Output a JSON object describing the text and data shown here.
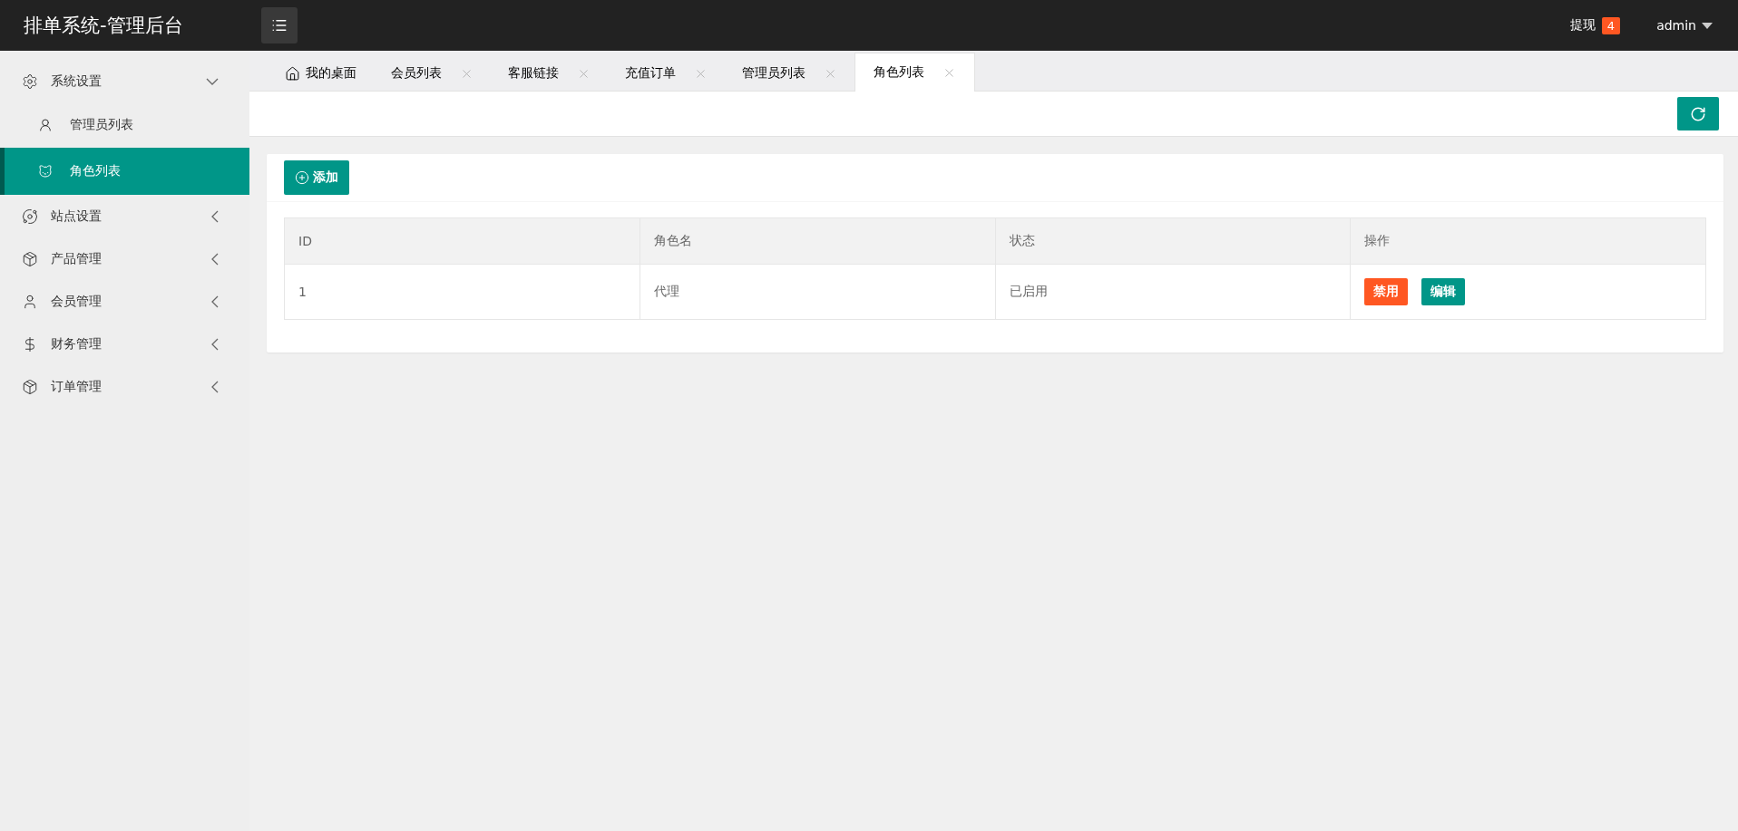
{
  "header": {
    "title": "排单系统-管理后台",
    "withdraw_label": "提现",
    "withdraw_count": "4",
    "user": "admin"
  },
  "sidebar": {
    "items": [
      {
        "label": "系统设置",
        "expanded": true,
        "children": [
          {
            "label": "管理员列表",
            "selected": false
          },
          {
            "label": "角色列表",
            "selected": true
          }
        ]
      },
      {
        "label": "站点设置",
        "expanded": false
      },
      {
        "label": "产品管理",
        "expanded": false
      },
      {
        "label": "会员管理",
        "expanded": false
      },
      {
        "label": "财务管理",
        "expanded": false
      },
      {
        "label": "订单管理",
        "expanded": false
      }
    ]
  },
  "tabs": [
    {
      "label": "我的桌面",
      "kind": "home",
      "selected": false
    },
    {
      "label": "会员列表",
      "kind": "closable",
      "selected": false
    },
    {
      "label": "客服链接",
      "kind": "closable",
      "selected": false
    },
    {
      "label": "充值订单",
      "kind": "closable",
      "selected": false
    },
    {
      "label": "管理员列表",
      "kind": "closable",
      "selected": false
    },
    {
      "label": "角色列表",
      "kind": "closable",
      "selected": true
    }
  ],
  "add_button": "添加",
  "table": {
    "columns": [
      "ID",
      "角色名",
      "状态",
      "操作"
    ],
    "rows": [
      {
        "cells": [
          "1",
          "代理",
          "已启用"
        ],
        "actions": [
          {
            "label": "禁用",
            "kind": "danger"
          },
          {
            "label": "编辑",
            "kind": "primary"
          }
        ]
      }
    ]
  }
}
